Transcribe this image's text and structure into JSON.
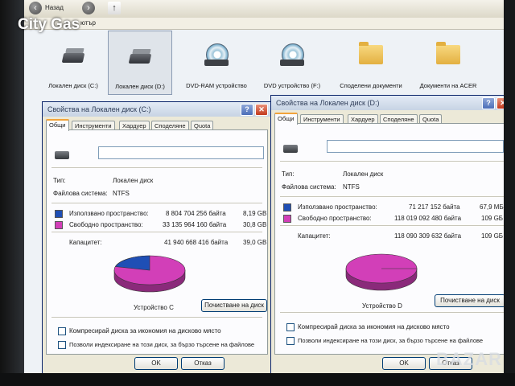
{
  "overlay": {
    "watermark": "City Gas",
    "brandmark": "BAZAR"
  },
  "explorer": {
    "back_label": "Назад",
    "address_fragment": "ютър",
    "drives": [
      {
        "icon": "hard-drive-icon",
        "label": "Локален диск (C:)"
      },
      {
        "icon": "hard-drive-icon",
        "label": "Локален диск (D:)",
        "selected": true
      },
      {
        "icon": "dvd-ram-drive-icon",
        "label": "DVD-RAM устройство"
      },
      {
        "icon": "dvd-drive-icon",
        "label": "DVD устройство (F:)"
      },
      {
        "icon": "folder-icon",
        "label": "Споделени документи"
      },
      {
        "icon": "folder-icon",
        "label": "Документи на ACER"
      }
    ]
  },
  "colors": {
    "used": "#1f4fb5",
    "free": "#d23fb8"
  },
  "dialog_c": {
    "title": "Свойства на Локален диск (C:)",
    "tabs": [
      "Общи",
      "Инструменти",
      "Хардуер",
      "Споделяне",
      "Quota"
    ],
    "type_label": "Тип:",
    "type_value": "Локален диск",
    "fs_label": "Файлова система:",
    "fs_value": "NTFS",
    "used_label": "Използвано пространство:",
    "used_bytes": "8 804 704 256 байта",
    "used_gb": "8,19 GB",
    "free_label": "Свободно пространство:",
    "free_bytes": "33 135 964 160 байта",
    "free_gb": "30,8 GB",
    "capacity_label": "Капацитет:",
    "capacity_bytes": "41 940 668 416 байта",
    "capacity_gb": "39,0 GB",
    "used_fraction": 0.21,
    "device_label": "Устройство C",
    "cleanup_button": "Почистване на диск",
    "compress_label": "Компресирай диска за икономия на дисково място",
    "index_label": "Позволи индексиране на този диск, за бързо търсене на файлове",
    "ok_button": "OK",
    "cancel_button": "Отказ",
    "help_btn": "?",
    "close_btn": "✕"
  },
  "dialog_d": {
    "title": "Свойства на Локален диск (D:)",
    "tabs": [
      "Общи",
      "Инструменти",
      "Хардуер",
      "Споделяне",
      "Quota"
    ],
    "type_label": "Тип:",
    "type_value": "Локален диск",
    "fs_label": "Файлова система:",
    "fs_value": "NTFS",
    "used_label": "Използвано пространство:",
    "used_bytes": "71 217 152 байта",
    "used_gb": "67,9 MБ",
    "free_label": "Свободно пространство:",
    "free_bytes": "118 019 092 480 байта",
    "free_gb": "109 GБ",
    "capacity_label": "Капацитет:",
    "capacity_bytes": "118 090 309 632 байта",
    "capacity_gb": "109 GБ",
    "used_fraction": 0.0006,
    "device_label": "Устройство D",
    "cleanup_button": "Почистване на диск",
    "compress_label": "Компресирай диска за икономия на дисково място",
    "index_label": "Позволи индексиране на този диск, за бързо търсене на файлове",
    "ok_button": "OK",
    "cancel_button": "Отказ",
    "help_btn": "?",
    "close_btn": "✕"
  }
}
